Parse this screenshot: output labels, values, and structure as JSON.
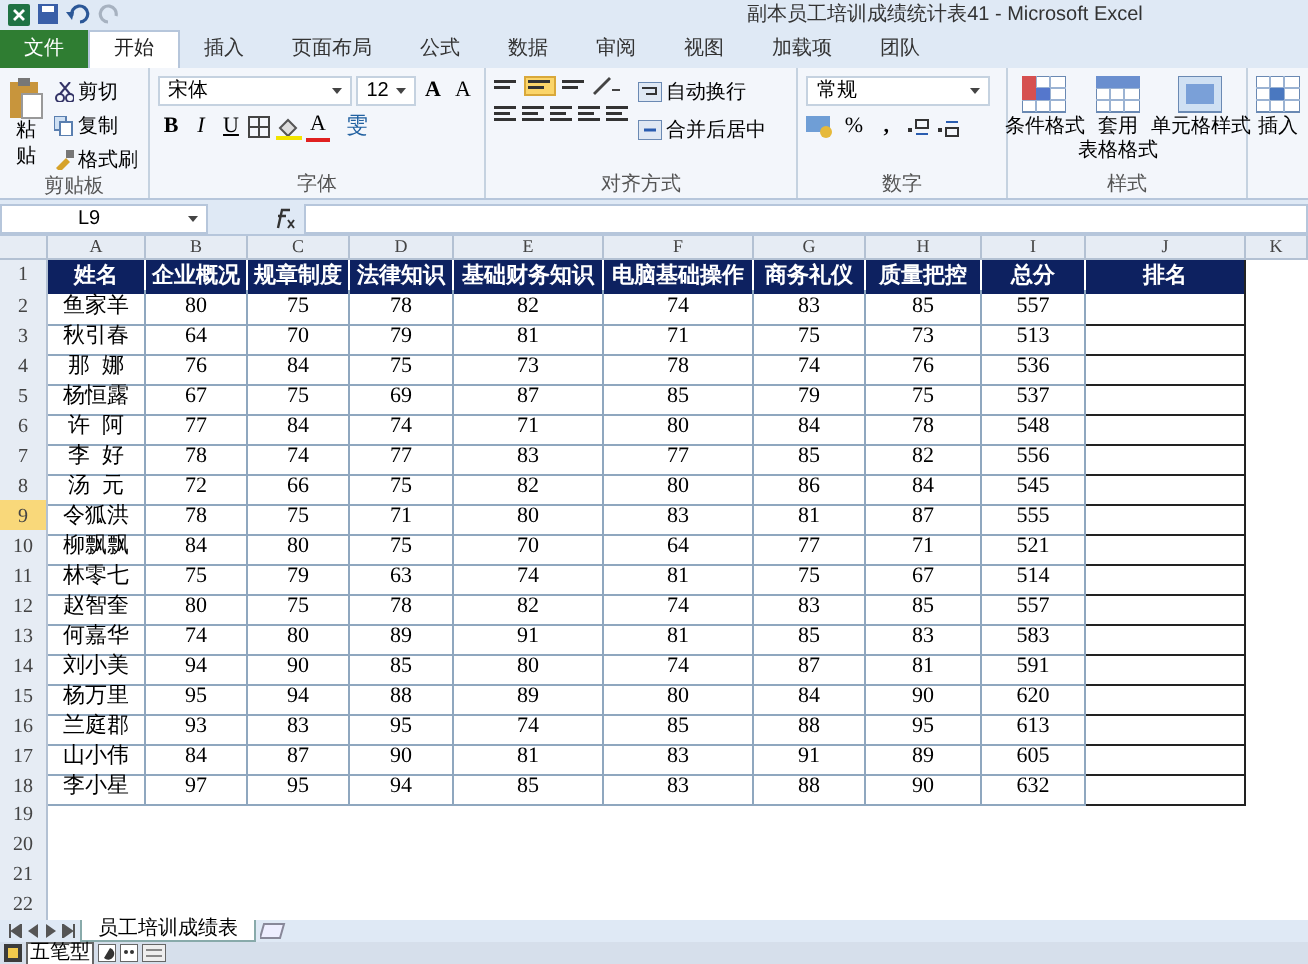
{
  "window": {
    "title": "副本员工培训成绩统计表41 - Microsoft Excel"
  },
  "ribbon_tabs": [
    {
      "label": "文件",
      "kind": "file",
      "selected": false
    },
    {
      "label": "开始",
      "kind": "tab",
      "selected": true
    },
    {
      "label": "插入",
      "kind": "tab",
      "selected": false
    },
    {
      "label": "页面布局",
      "kind": "tab",
      "selected": false
    },
    {
      "label": "公式",
      "kind": "tab",
      "selected": false
    },
    {
      "label": "数据",
      "kind": "tab",
      "selected": false
    },
    {
      "label": "审阅",
      "kind": "tab",
      "selected": false
    },
    {
      "label": "视图",
      "kind": "tab",
      "selected": false
    },
    {
      "label": "加载项",
      "kind": "tab",
      "selected": false
    },
    {
      "label": "团队",
      "kind": "tab",
      "selected": false
    }
  ],
  "clipboard": {
    "paste": "粘贴",
    "cut": "剪切",
    "copy": "复制",
    "format_painter": "格式刷",
    "group_label": "剪贴板"
  },
  "font": {
    "font_name": "宋体",
    "font_size": "12",
    "grow": "A",
    "shrink": "A",
    "style_buttons": [
      "B",
      "I",
      "U"
    ],
    "font_color": "A",
    "phonetic": "雯",
    "group_label": "字体"
  },
  "alignment": {
    "wrap_text": "自动换行",
    "merge_center": "合并后居中",
    "group_label": "对齐方式"
  },
  "number": {
    "format": "常规",
    "percent": "%",
    "comma": ",",
    "group_label": "数字"
  },
  "styles": {
    "conditional_format": "条件格式",
    "table_format": [
      "套用",
      "表格格式"
    ],
    "cell_styles": "单元格样式",
    "group_label": "样式"
  },
  "cells": {
    "insert": "插入"
  },
  "formula_bar": {
    "name_box": "L9"
  },
  "columns": [
    "A",
    "B",
    "C",
    "D",
    "E",
    "F",
    "G",
    "H",
    "I",
    "J",
    "K"
  ],
  "row_headers": [
    {
      "label": "1",
      "selected": false
    },
    {
      "label": "2",
      "selected": false
    },
    {
      "label": "3",
      "selected": false
    },
    {
      "label": "4",
      "selected": false
    },
    {
      "label": "5",
      "selected": false
    },
    {
      "label": "6",
      "selected": false
    },
    {
      "label": "7",
      "selected": false
    },
    {
      "label": "8",
      "selected": false
    },
    {
      "label": "9",
      "selected": true
    },
    {
      "label": "10",
      "selected": false
    },
    {
      "label": "11",
      "selected": false
    },
    {
      "label": "12",
      "selected": false
    },
    {
      "label": "13",
      "selected": false
    },
    {
      "label": "14",
      "selected": false
    },
    {
      "label": "15",
      "selected": false
    },
    {
      "label": "16",
      "selected": false
    },
    {
      "label": "17",
      "selected": false
    },
    {
      "label": "18",
      "selected": false
    },
    {
      "label": "19",
      "selected": false
    },
    {
      "label": "20",
      "selected": false
    },
    {
      "label": "21",
      "selected": false
    },
    {
      "label": "22",
      "selected": false
    }
  ],
  "table": {
    "headers": [
      "姓名",
      "企业概况",
      "规章制度",
      "法律知识",
      "基础财务知识",
      "电脑基础操作",
      "商务礼仪",
      "质量把控",
      "总分",
      "排名"
    ],
    "rows": [
      [
        "鱼家羊",
        "80",
        "75",
        "78",
        "82",
        "74",
        "83",
        "85",
        "557"
      ],
      [
        "秋引春",
        "64",
        "70",
        "79",
        "81",
        "71",
        "75",
        "73",
        "513"
      ],
      [
        "那  娜",
        "76",
        "84",
        "75",
        "73",
        "78",
        "74",
        "76",
        "536"
      ],
      [
        "杨恒露",
        "67",
        "75",
        "69",
        "87",
        "85",
        "79",
        "75",
        "537"
      ],
      [
        "许  阿",
        "77",
        "84",
        "74",
        "71",
        "80",
        "84",
        "78",
        "548"
      ],
      [
        "李  好",
        "78",
        "74",
        "77",
        "83",
        "77",
        "85",
        "82",
        "556"
      ],
      [
        "汤  元",
        "72",
        "66",
        "75",
        "82",
        "80",
        "86",
        "84",
        "545"
      ],
      [
        "令狐洪",
        "78",
        "75",
        "71",
        "80",
        "83",
        "81",
        "87",
        "555"
      ],
      [
        "柳飘飘",
        "84",
        "80",
        "75",
        "70",
        "64",
        "77",
        "71",
        "521"
      ],
      [
        "林零七",
        "75",
        "79",
        "63",
        "74",
        "81",
        "75",
        "67",
        "514"
      ],
      [
        "赵智奎",
        "80",
        "75",
        "78",
        "82",
        "74",
        "83",
        "85",
        "557"
      ],
      [
        "何嘉华",
        "74",
        "80",
        "89",
        "91",
        "81",
        "85",
        "83",
        "583"
      ],
      [
        "刘小美",
        "94",
        "90",
        "85",
        "80",
        "74",
        "87",
        "81",
        "591"
      ],
      [
        "杨万里",
        "95",
        "94",
        "88",
        "89",
        "80",
        "84",
        "90",
        "620"
      ],
      [
        "兰庭郡",
        "93",
        "83",
        "95",
        "74",
        "85",
        "88",
        "95",
        "613"
      ],
      [
        "山小伟",
        "84",
        "87",
        "90",
        "81",
        "83",
        "91",
        "89",
        "605"
      ],
      [
        "李小星",
        "97",
        "95",
        "94",
        "85",
        "83",
        "88",
        "90",
        "632"
      ]
    ]
  },
  "sheet_tabs": [
    {
      "label": "员工培训成绩表",
      "selected": true
    }
  ],
  "status_bar": {
    "input_method": "五笔型"
  }
}
